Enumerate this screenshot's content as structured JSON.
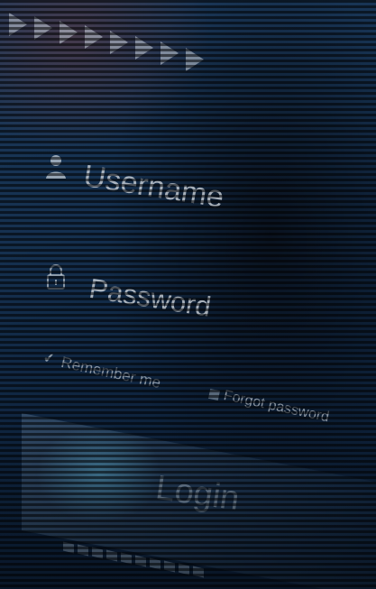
{
  "form": {
    "username_label": "Username",
    "password_label": "Password",
    "remember_label": "Remember me",
    "forgot_label": "Forgot password",
    "login_label": "Login"
  },
  "icons": {
    "user": "user-icon",
    "lock": "lock-icon",
    "check": "check-icon",
    "arrows": "chevron-right-icon"
  },
  "colors": {
    "background": "#0f2540",
    "text": "#c8d0d8"
  }
}
